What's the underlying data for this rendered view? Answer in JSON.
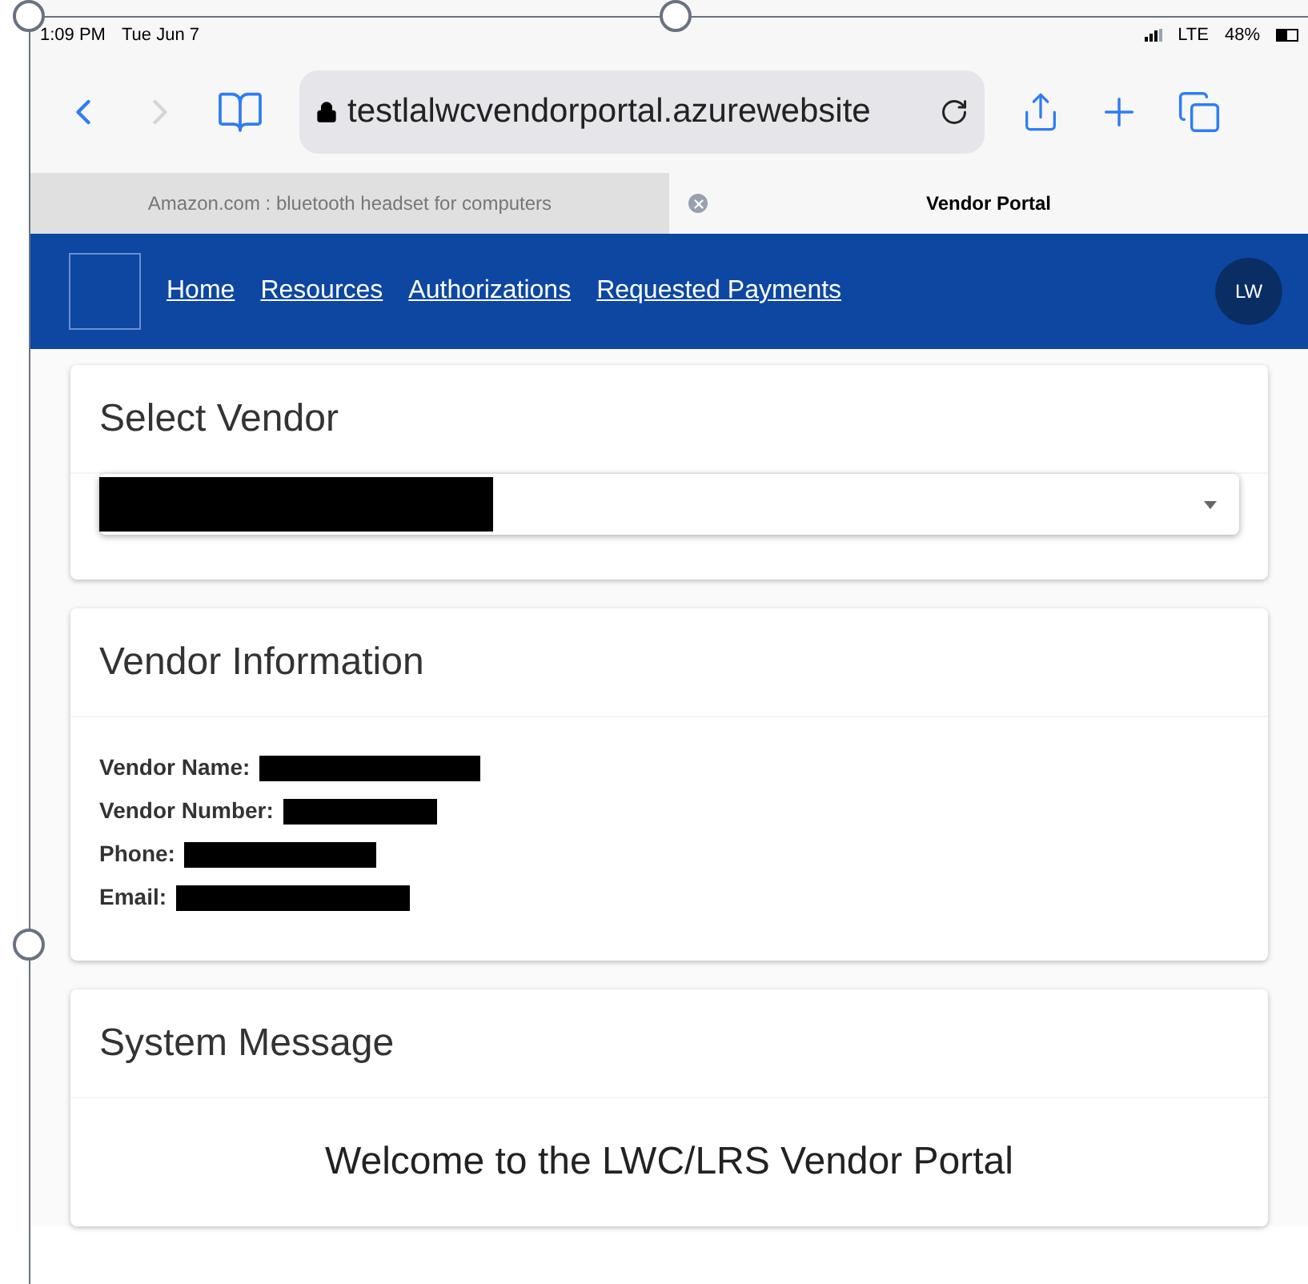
{
  "status_bar": {
    "time": "1:09 PM",
    "date": "Tue Jun 7",
    "network": "LTE",
    "battery": "48%"
  },
  "browser": {
    "url": "testlalwcvendorportal.azurewebsite"
  },
  "tabs": [
    {
      "label": "Amazon.com : bluetooth headset for computers",
      "selected": false
    },
    {
      "label": "Vendor Portal",
      "selected": true
    }
  ],
  "nav": {
    "links": [
      "Home",
      "Resources",
      "Authorizations",
      "Requested Payments"
    ],
    "avatar": "LW"
  },
  "select_vendor": {
    "title": "Select Vendor"
  },
  "vendor_information": {
    "title": "Vendor Information",
    "fields": [
      {
        "label": "Vendor Name:"
      },
      {
        "label": "Vendor Number:"
      },
      {
        "label": "Phone:"
      },
      {
        "label": "Email:"
      }
    ]
  },
  "system_message": {
    "title": "System Message",
    "message": "Welcome to the LWC/LRS Vendor Portal"
  }
}
